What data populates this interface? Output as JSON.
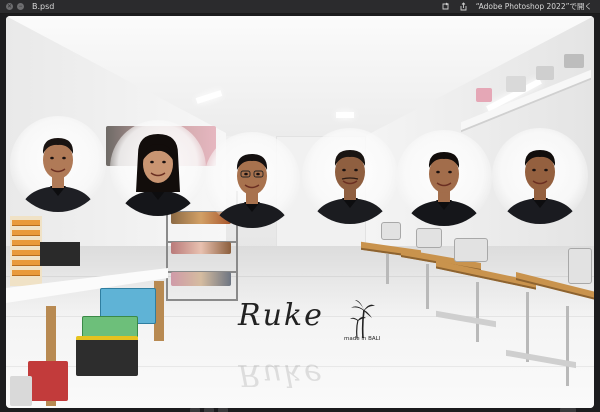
{
  "window": {
    "filename": "B.psd",
    "open_with": "“Adobe Photoshop 2022”で開く",
    "icons": [
      "close-icon",
      "minimize-icon",
      "rotate-icon",
      "share-icon"
    ]
  },
  "image": {
    "logo_text": "Ruke",
    "logo_subtext": "made in BALI",
    "logo_icon": "palm-tree-icon",
    "people": [
      {
        "name": "person-1",
        "shirt": "#1e1f24",
        "skin": "#b07a57",
        "hair": "#1a1412"
      },
      {
        "name": "person-2",
        "shirt": "#15161a",
        "skin": "#c99572",
        "hair": "#120d0b"
      },
      {
        "name": "person-3",
        "shirt": "#1a1b1f",
        "skin": "#a8724e",
        "hair": "#141010"
      },
      {
        "name": "person-4",
        "shirt": "#1b1c20",
        "skin": "#8f5f40",
        "hair": "#1a1512"
      },
      {
        "name": "person-5",
        "shirt": "#15161a",
        "skin": "#a26d4b",
        "hair": "#110d0b"
      },
      {
        "name": "person-6",
        "shirt": "#1a1b20",
        "skin": "#94603f",
        "hair": "#120e0c"
      }
    ]
  }
}
